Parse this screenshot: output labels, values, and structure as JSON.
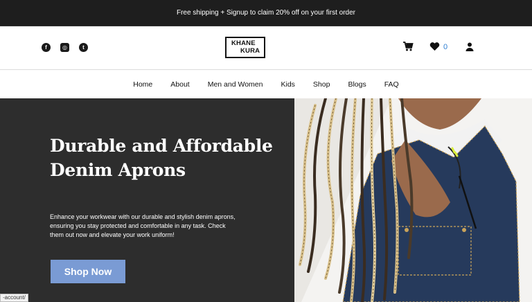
{
  "announcement": "Free shipping + Signup to claim 20% off on your first order",
  "header": {
    "logo_line1": "KHANE",
    "logo_line2": "KURA",
    "socials": [
      {
        "name": "facebook",
        "glyph": "f"
      },
      {
        "name": "instagram",
        "glyph": "◎"
      },
      {
        "name": "twitter",
        "glyph": "t"
      }
    ],
    "wishlist_count": "0"
  },
  "nav": {
    "items": [
      "Home",
      "About",
      "Men and Women",
      "Kids",
      "Shop",
      "Blogs",
      "FAQ"
    ]
  },
  "hero": {
    "title": "Durable and Affordable Denim Aprons",
    "description": "Enhance your workwear with our durable and stylish denim aprons, ensuring you stay protected and comfortable in any task. Check them out now and elevate your work uniform!",
    "cta": "Shop Now",
    "image": "woman-in-denim-apron-with-braids"
  },
  "status_bar": {
    "url": "-account/"
  },
  "colors": {
    "announcement_bg": "#1e1e1e",
    "hero_bg": "#2d2d2d",
    "cta_bg": "#7a9bd4",
    "wishlist_count": "#2f7fd2"
  }
}
